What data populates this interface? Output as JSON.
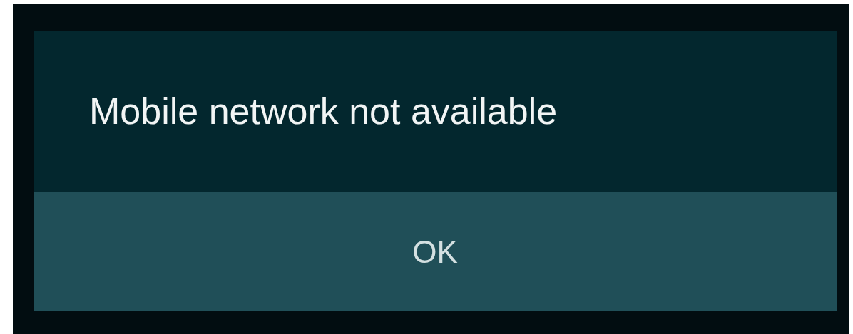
{
  "dialog": {
    "message": "Mobile network not available",
    "buttons": [
      "OK"
    ]
  }
}
